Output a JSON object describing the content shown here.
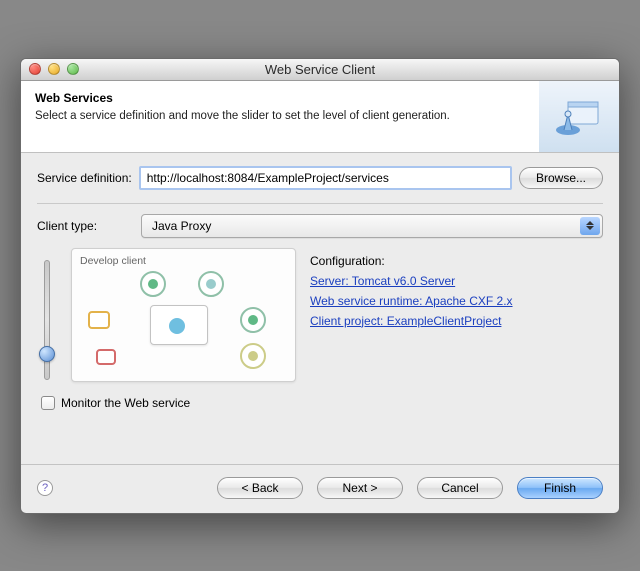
{
  "window": {
    "title": "Web Service Client"
  },
  "banner": {
    "heading": "Web Services",
    "description": "Select a service definition and move the slider to set the level of client generation."
  },
  "serviceDef": {
    "label": "Service definition:",
    "value": "http://localhost:8084/ExampleProject/services",
    "browse": "Browse..."
  },
  "clientType": {
    "label": "Client type:",
    "selected": "Java Proxy"
  },
  "preview": {
    "stage": "Develop client"
  },
  "config": {
    "heading": "Configuration:",
    "links": {
      "server": "Server: Tomcat v6.0 Server",
      "runtime": "Web service runtime: Apache CXF 2.x",
      "project": "Client project: ExampleClientProject"
    }
  },
  "monitor": {
    "label": "Monitor the Web service",
    "checked": false
  },
  "buttons": {
    "back": "< Back",
    "next": "Next >",
    "cancel": "Cancel",
    "finish": "Finish"
  }
}
